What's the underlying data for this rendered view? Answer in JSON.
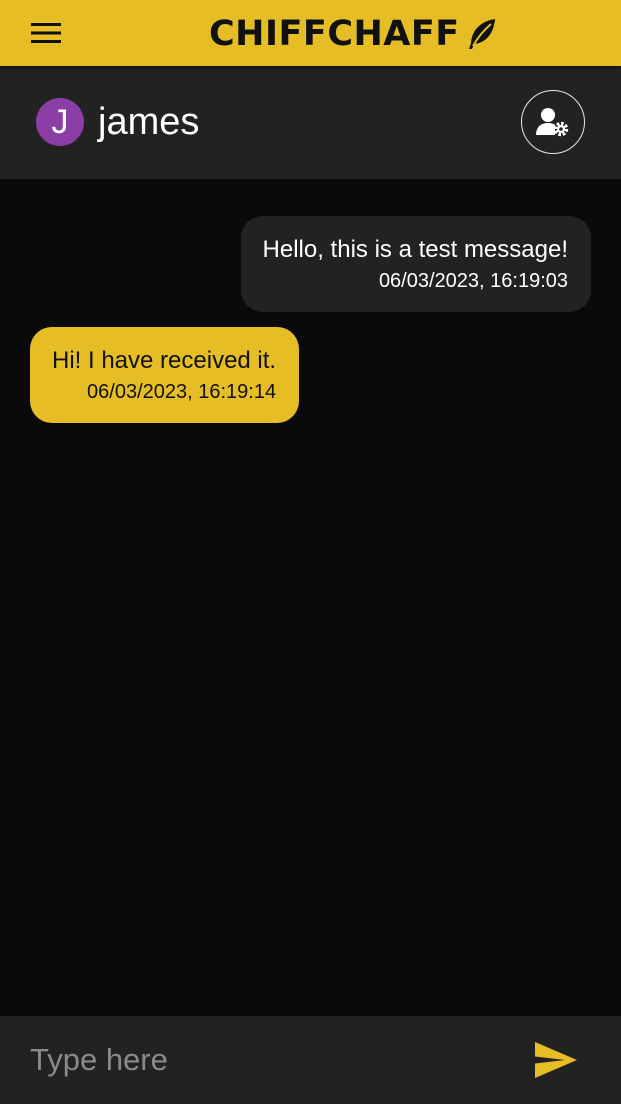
{
  "app": {
    "brand": "CHIFFCHAFF",
    "icons": {
      "menu": "hamburger-menu-icon",
      "brand": "feather-icon"
    },
    "colors": {
      "accent": "#e6bd25",
      "background": "#0a0a0a",
      "surface": "#222222",
      "avatar": "#8a3ea6"
    }
  },
  "chat_header": {
    "avatar_initial": "J",
    "contact_name": "james",
    "settings_icon": "user-settings-icon"
  },
  "messages": [
    {
      "direction": "sent",
      "text": "Hello, this is a test message!",
      "timestamp": "06/03/2023, 16:19:03"
    },
    {
      "direction": "received",
      "text": "Hi! I have received it.",
      "timestamp": "06/03/2023, 16:19:14"
    }
  ],
  "composer": {
    "placeholder": "Type here",
    "value": "",
    "send_icon": "send-icon"
  }
}
